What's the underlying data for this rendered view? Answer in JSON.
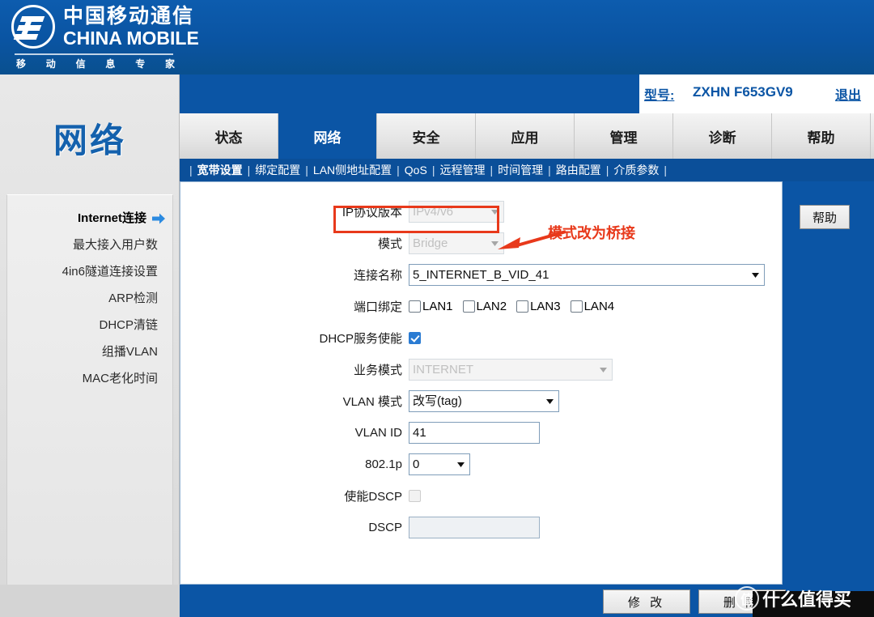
{
  "brand": {
    "cn_name": "中国移动通信",
    "en_name": "CHINA MOBILE",
    "slogan_chars": [
      "移",
      "动",
      "信",
      "息",
      "专",
      "家"
    ],
    "logo_icon": "china-mobile-logo-icon"
  },
  "header": {
    "model_label": "型号:",
    "model_value": "ZXHN F653GV9",
    "logout_label": "退出"
  },
  "section": {
    "title": "网络"
  },
  "tabs": [
    {
      "label": "状态",
      "active": false
    },
    {
      "label": "网络",
      "active": true
    },
    {
      "label": "安全",
      "active": false
    },
    {
      "label": "应用",
      "active": false
    },
    {
      "label": "管理",
      "active": false
    },
    {
      "label": "诊断",
      "active": false
    },
    {
      "label": "帮助",
      "active": false
    }
  ],
  "subnav": [
    {
      "label": "宽带设置",
      "active": true
    },
    {
      "label": "绑定配置",
      "active": false
    },
    {
      "label": "LAN侧地址配置",
      "active": false
    },
    {
      "label": "QoS",
      "active": false
    },
    {
      "label": "远程管理",
      "active": false
    },
    {
      "label": "时间管理",
      "active": false
    },
    {
      "label": "路由配置",
      "active": false
    },
    {
      "label": "介质参数",
      "active": false
    }
  ],
  "sidebar": {
    "items": [
      {
        "label": "Internet连接",
        "active": true
      },
      {
        "label": "最大接入用户数",
        "active": false
      },
      {
        "label": "4in6隧道连接设置",
        "active": false
      },
      {
        "label": "ARP检测",
        "active": false
      },
      {
        "label": "DHCP清链",
        "active": false
      },
      {
        "label": "组播VLAN",
        "active": false
      },
      {
        "label": "MAC老化时间",
        "active": false
      }
    ]
  },
  "form": {
    "ip_version": {
      "label": "IP协议版本",
      "value": "IPv4/v6",
      "disabled": true
    },
    "mode": {
      "label": "模式",
      "value": "Bridge",
      "disabled": true
    },
    "conn_name": {
      "label": "连接名称",
      "value": "5_INTERNET_B_VID_41",
      "disabled": false
    },
    "port_bind": {
      "label": "端口绑定",
      "options": [
        {
          "label": "LAN1",
          "checked": false
        },
        {
          "label": "LAN2",
          "checked": false
        },
        {
          "label": "LAN3",
          "checked": false
        },
        {
          "label": "LAN4",
          "checked": false
        }
      ]
    },
    "dhcp_enable": {
      "label": "DHCP服务使能",
      "checked": true
    },
    "service_mode": {
      "label": "业务模式",
      "value": "INTERNET",
      "disabled": true
    },
    "vlan_mode": {
      "label": "VLAN 模式",
      "value": "改写(tag)",
      "disabled": false
    },
    "vlan_id": {
      "label": "VLAN ID",
      "value": "41"
    },
    "dot1p": {
      "label": "802.1p",
      "value": "0"
    },
    "dscp_enable": {
      "label": "使能DSCP",
      "checked": false,
      "disabled": true
    },
    "dscp": {
      "label": "DSCP",
      "value": "",
      "disabled": true
    }
  },
  "annotation": {
    "text": "模式改为桥接",
    "color": "#e8391b"
  },
  "buttons": {
    "help": "帮助",
    "modify": "修 改",
    "delete": "删 除"
  },
  "watermark": {
    "badge": "值",
    "text": "什么值得买"
  },
  "colors": {
    "brand_blue": "#0b55a5",
    "subnav_blue": "#0b4f99",
    "accent_red": "#e8391b",
    "checkbox_blue": "#2b7cd3"
  }
}
